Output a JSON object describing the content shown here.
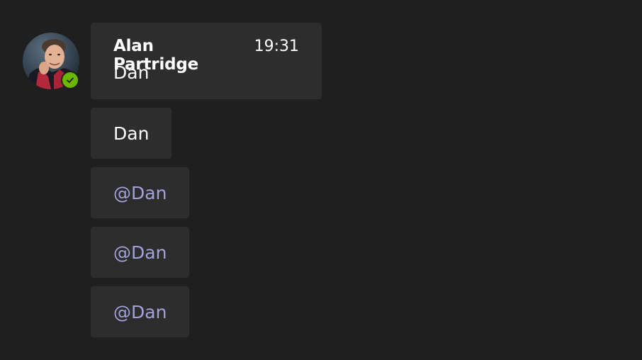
{
  "message_group": {
    "author": "Alan Partridge",
    "timestamp": "19:31",
    "presence": "available",
    "messages": [
      {
        "text": "Dan",
        "type": "plain"
      },
      {
        "text": "Dan",
        "type": "plain"
      },
      {
        "text": "@Dan",
        "type": "mention"
      },
      {
        "text": "@Dan",
        "type": "mention"
      },
      {
        "text": "@Dan",
        "type": "mention"
      }
    ]
  },
  "colors": {
    "background": "#1f1f1f",
    "bubble": "#2d2d2d",
    "text": "#ffffff",
    "mention": "#a4a1d8",
    "presence_available": "#6bb700"
  },
  "icons": {
    "presence": "checkmark-icon"
  }
}
